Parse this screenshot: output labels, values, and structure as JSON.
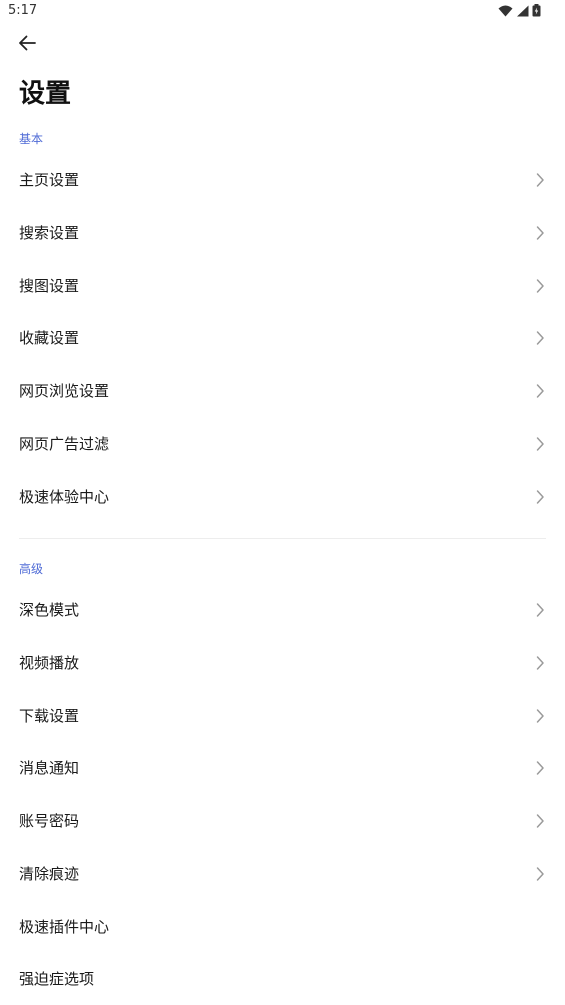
{
  "status_bar": {
    "time": "5:17",
    "icons": [
      "wifi-icon",
      "cell-signal-icon",
      "battery-icon"
    ]
  },
  "header": {
    "back_icon": "arrow-left-icon",
    "title": "设置"
  },
  "colors": {
    "section_header": "#4f6bd6",
    "text": "#1a1a1a",
    "chevron": "#9a9a9a",
    "divider": "#ededed"
  },
  "sections": [
    {
      "header": "基本",
      "items": [
        {
          "label": "主页设置"
        },
        {
          "label": "搜索设置"
        },
        {
          "label": "搜图设置"
        },
        {
          "label": "收藏设置"
        },
        {
          "label": "网页浏览设置"
        },
        {
          "label": "网页广告过滤"
        },
        {
          "label": "极速体验中心"
        }
      ]
    },
    {
      "header": "高级",
      "items": [
        {
          "label": "深色模式"
        },
        {
          "label": "视频播放"
        },
        {
          "label": "下载设置"
        },
        {
          "label": "消息通知"
        },
        {
          "label": "账号密码"
        },
        {
          "label": "清除痕迹"
        },
        {
          "label": "极速插件中心"
        },
        {
          "label": "强迫症选项"
        }
      ]
    }
  ]
}
